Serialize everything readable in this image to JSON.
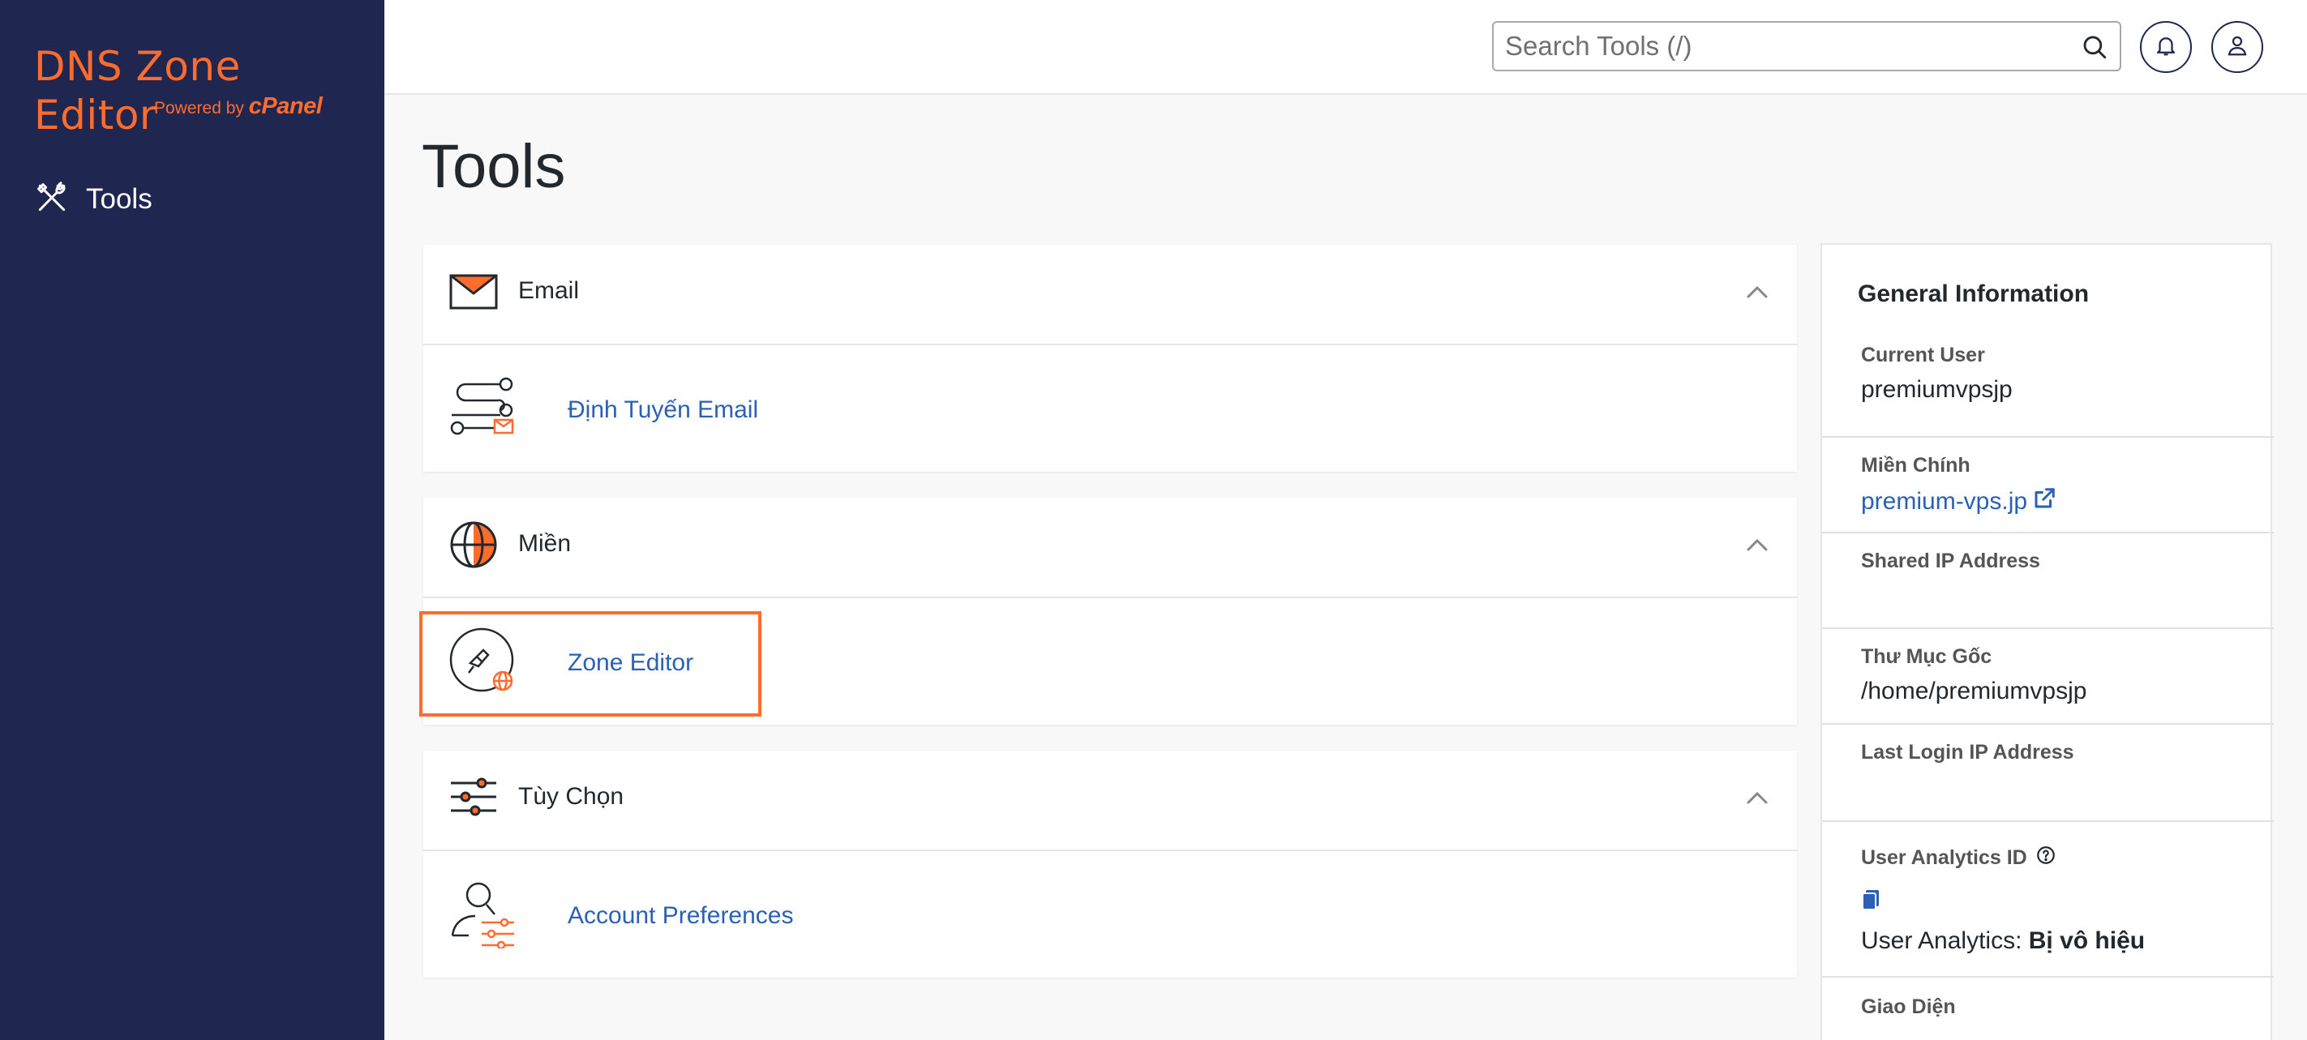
{
  "app": {
    "title": "DNS Zone Editor",
    "powered_prefix": "Powered by",
    "powered_brand": "cPanel",
    "brand_color": "#ff6c2c",
    "sidebar_color": "#1f2650"
  },
  "sidebar": {
    "items": [
      {
        "label": "Tools",
        "icon": "tools-icon"
      }
    ]
  },
  "header": {
    "search": {
      "placeholder": "Search Tools (/)",
      "value": ""
    },
    "notifications_icon": "bell-icon",
    "user_icon": "user-icon"
  },
  "main": {
    "page_title": "Tools",
    "sections": [
      {
        "title": "Email",
        "icon": "envelope-icon",
        "tools": [
          {
            "label": "Định Tuyến Email",
            "icon": "email-routing-icon"
          }
        ]
      },
      {
        "title": "Miền",
        "icon": "globe-icon",
        "tools": [
          {
            "label": "Zone Editor",
            "icon": "zone-editor-icon",
            "highlighted": true
          }
        ]
      },
      {
        "title": "Tùy Chọn",
        "icon": "sliders-icon",
        "tools": [
          {
            "label": "Account Preferences",
            "icon": "account-preferences-icon"
          }
        ]
      }
    ]
  },
  "general_info": {
    "title": "General Information",
    "current_user": {
      "label": "Current User",
      "value": "premiumvpsjp"
    },
    "primary_domain": {
      "label": "Miền Chính",
      "value": "premium-vps.jp"
    },
    "shared_ip": {
      "label": "Shared IP Address",
      "value": ""
    },
    "home_dir": {
      "label": "Thư Mục Gốc",
      "value": "/home/premiumvpsjp"
    },
    "last_login_ip": {
      "label": "Last Login IP Address",
      "value": ""
    },
    "analytics_id": {
      "label": "User Analytics ID"
    },
    "analytics_status": {
      "label": "User Analytics:",
      "value": "Bị vô hiệu"
    },
    "theme": {
      "label": "Giao Diện"
    }
  }
}
